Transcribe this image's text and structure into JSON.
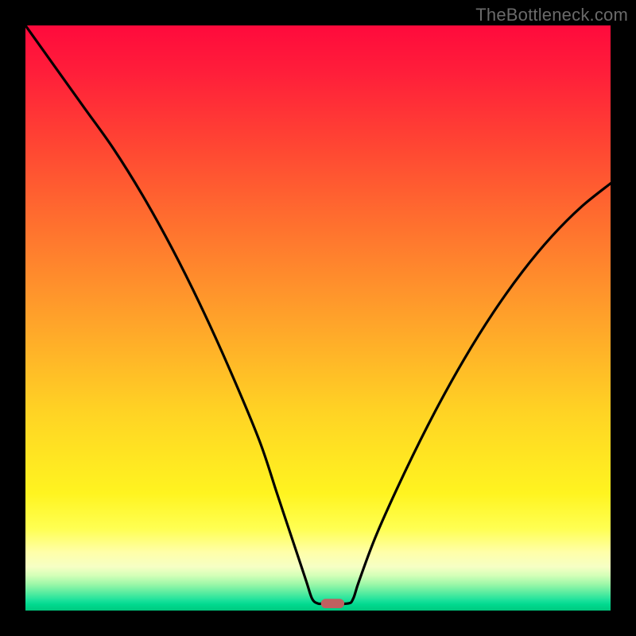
{
  "watermark": "TheBottleneck.com",
  "chart_data": {
    "type": "line",
    "title": "",
    "xlabel": "",
    "ylabel": "",
    "xlim": [
      0,
      100
    ],
    "ylim": [
      0,
      100
    ],
    "grid": false,
    "legend": false,
    "background_gradient": {
      "orientation": "vertical",
      "top_color": "#ff0a3c",
      "bottom_color": "#00c97e"
    },
    "series": [
      {
        "name": "bottleneck-curve",
        "color": "#000000",
        "x": [
          0,
          5,
          10,
          15,
          20,
          25,
          30,
          35,
          40,
          43,
          46,
          48,
          49,
          50,
          51,
          55,
          56,
          57,
          60,
          65,
          70,
          75,
          80,
          85,
          90,
          95,
          100
        ],
        "y": [
          100,
          93,
          86,
          79,
          71,
          62,
          52,
          41,
          29,
          20,
          11,
          5,
          2,
          1.2,
          1.2,
          1.2,
          2,
          5,
          13,
          24,
          34,
          43,
          51,
          58,
          64,
          69,
          73
        ]
      }
    ],
    "marker": {
      "name": "optimal-point",
      "shape": "pill",
      "color": "#c06060",
      "x_center": 52.5,
      "y_center": 1.2,
      "width_pct": 4,
      "height_pct": 1.6
    }
  }
}
